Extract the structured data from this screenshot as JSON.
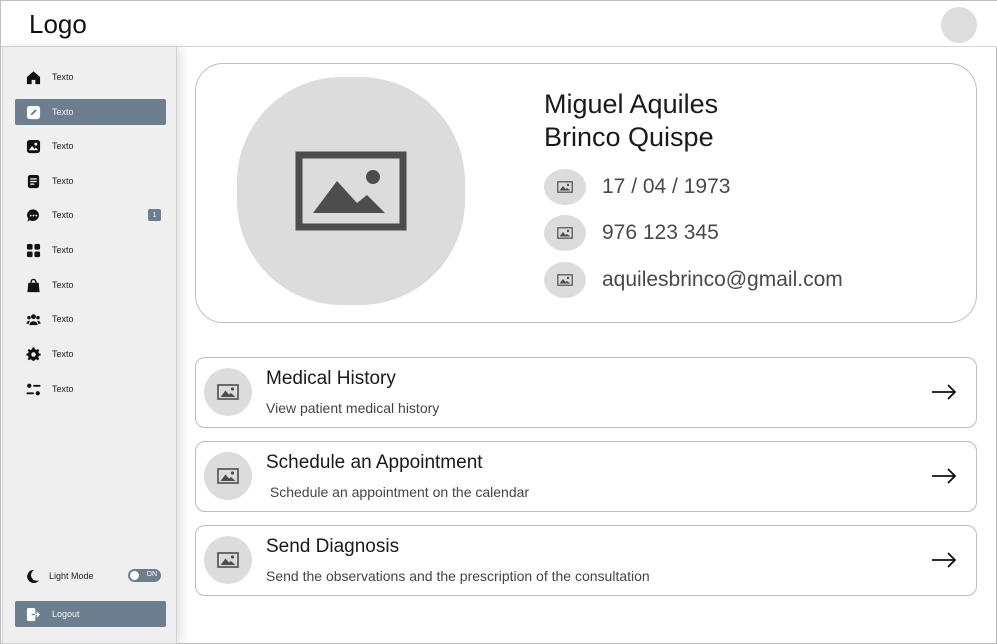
{
  "header": {
    "logo": "Logo"
  },
  "sidebar": {
    "items": [
      {
        "label": "Texto",
        "icon": "home-icon"
      },
      {
        "label": "Texto",
        "icon": "edit-icon",
        "active": true
      },
      {
        "label": "Texto",
        "icon": "image-icon"
      },
      {
        "label": "Texto",
        "icon": "document-icon"
      },
      {
        "label": "Texto",
        "icon": "chat-icon",
        "badge": "1"
      },
      {
        "label": "Texto",
        "icon": "grid-icon"
      },
      {
        "label": "Texto",
        "icon": "bag-icon"
      },
      {
        "label": "Texto",
        "icon": "users-icon"
      },
      {
        "label": "Texto",
        "icon": "gear-icon"
      },
      {
        "label": "Texto",
        "icon": "filters-icon"
      }
    ],
    "mode_label": "Light Mode",
    "mode_toggle": "ON",
    "logout_label": "Logout"
  },
  "profile": {
    "name_line1": "Miguel Aquiles",
    "name_line2": "Brinco Quispe",
    "birth_date": "17 / 04 / 1973",
    "phone": "976 123 345",
    "email": "aquilesbrinco@gmail.com"
  },
  "actions": [
    {
      "title": "Medical History",
      "subtitle": "View patient medical history"
    },
    {
      "title": "Schedule an Appointment",
      "subtitle": " Schedule an appointment on the calendar"
    },
    {
      "title": "Send Diagnosis",
      "subtitle": "Send the observations and the prescription of the consultation"
    }
  ],
  "colors": {
    "accent": "#6d7f8e",
    "placeholder": "#dcdcdc",
    "icon_dark": "#4d4d4d"
  }
}
